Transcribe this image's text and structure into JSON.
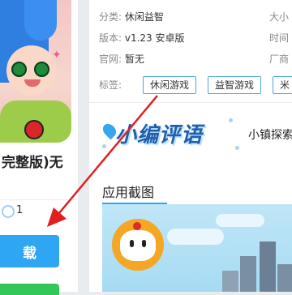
{
  "app": {
    "title_fragment": "完整版)无",
    "share_count": "1",
    "download_label": "载"
  },
  "info": {
    "category_key": "分类:",
    "category_value": "休闲益智",
    "version_key": "版本:",
    "version_value": "v1.23 安卓版",
    "website_key": "官网:",
    "website_value": "暂无",
    "size_key_fragment": "大小",
    "time_key_fragment": "时间",
    "vendor_key_fragment": "厂商"
  },
  "tags": {
    "label": "标签:",
    "items": [
      "休闲游戏",
      "益智游戏",
      "米"
    ]
  },
  "banner": {
    "logo_text": "小编评语",
    "text": "小镇探索"
  },
  "screenshots": {
    "title": "应用截图"
  },
  "colors": {
    "accent": "#2ea6f2",
    "tag_border": "#4aa8e8",
    "download_bg": "#2ea6f2",
    "secondary_button": "#33c759",
    "arrow": "#e02020"
  }
}
